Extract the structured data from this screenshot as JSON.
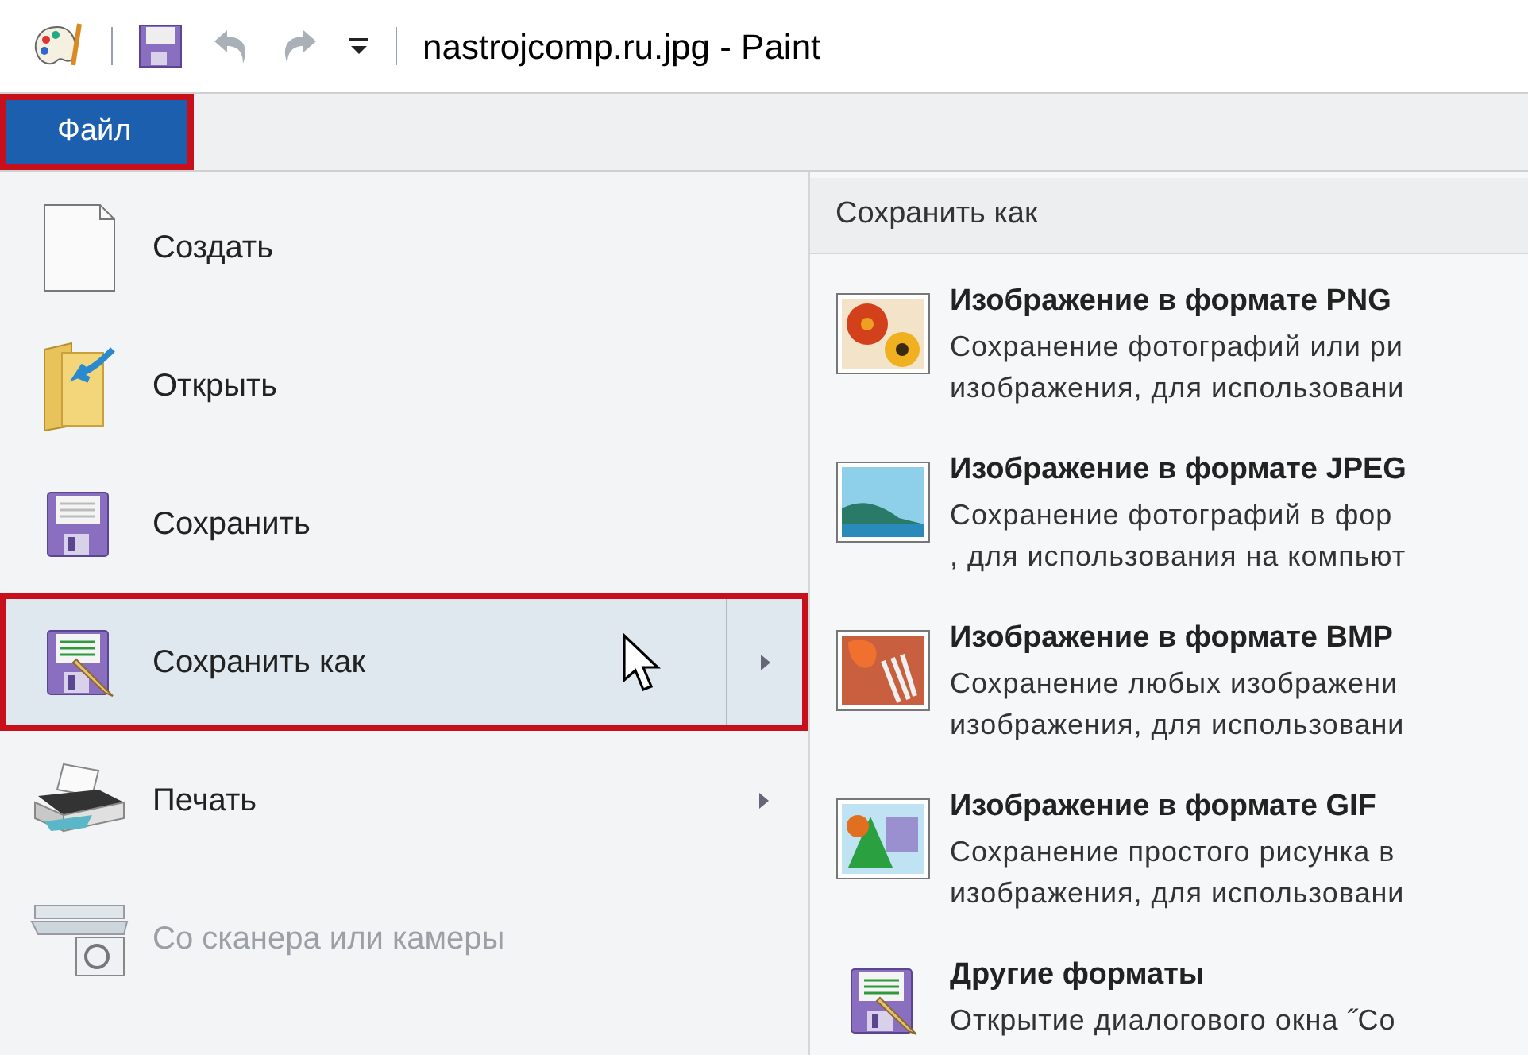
{
  "window": {
    "title": "nastrojcomp.ru.jpg - Paint"
  },
  "file_tab": {
    "label": "Файл",
    "annotated": true
  },
  "menu_items": [
    {
      "kind": "new",
      "label": "Создать",
      "selected": false,
      "disabled": false,
      "has_submenu": false,
      "annotated": false
    },
    {
      "kind": "open",
      "label": "Открыть",
      "selected": false,
      "disabled": false,
      "has_submenu": false,
      "annotated": false
    },
    {
      "kind": "save",
      "label": "Сохранить",
      "selected": false,
      "disabled": false,
      "has_submenu": false,
      "annotated": false
    },
    {
      "kind": "save_as",
      "label": "Сохранить как",
      "selected": true,
      "disabled": false,
      "has_submenu": true,
      "annotated": true
    },
    {
      "kind": "print",
      "label": "Печать",
      "selected": false,
      "disabled": false,
      "has_submenu": true,
      "annotated": false
    },
    {
      "kind": "scanner",
      "label": "Со сканера или камеры",
      "selected": false,
      "disabled": true,
      "has_submenu": false,
      "annotated": false
    }
  ],
  "submenu": {
    "title": "Сохранить как",
    "items": [
      {
        "kind": "png",
        "title": "Изображение в формате PNG",
        "lines": [
          "Сохранение фотографий или ри",
          "изображения, для использовани"
        ]
      },
      {
        "kind": "jpeg",
        "title": "Изображение в формате JPEG",
        "lines": [
          "Сохранение фотографий в фор",
          ", для использования на компьют"
        ]
      },
      {
        "kind": "bmp",
        "title": "Изображение в формате BMP",
        "lines": [
          "Сохранение любых изображени",
          "изображения, для использовани"
        ]
      },
      {
        "kind": "gif",
        "title": "Изображение в формате GIF",
        "lines": [
          "Сохранение простого рисунка в",
          "изображения, для использовани"
        ]
      },
      {
        "kind": "other",
        "title": "Другие форматы",
        "lines": [
          "Открытие диалогового окна ˝Со"
        ]
      }
    ]
  }
}
